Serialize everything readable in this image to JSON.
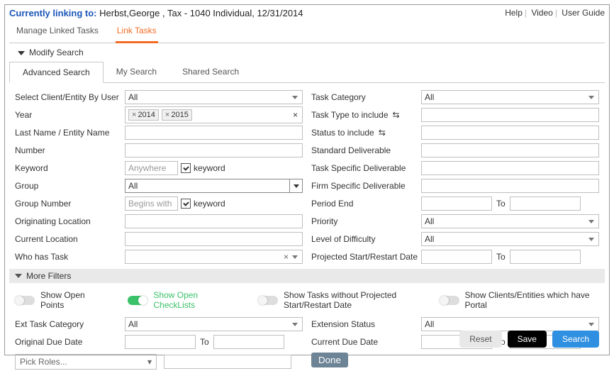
{
  "header": {
    "linking_label": "Currently linking to:",
    "linking_value": "Herbst,George , Tax - 1040 Individual, 12/31/2014",
    "help": "Help",
    "video": "Video",
    "guide": "User Guide"
  },
  "tabs_main": {
    "manage": "Manage Linked Tasks",
    "link": "Link Tasks"
  },
  "modify": "Modify Search",
  "tabs_sub": {
    "adv": "Advanced Search",
    "my": "My Search",
    "shared": "Shared Search"
  },
  "left": {
    "select_user": "Select Client/Entity By User",
    "all": "All",
    "year": "Year",
    "chip1": "2014",
    "chip2": "2015",
    "lastname": "Last Name / Entity Name",
    "number": "Number",
    "keyword": "Keyword",
    "kw_mode": "Anywhere",
    "kw_hint": "keyword",
    "group": "Group",
    "groupnum": "Group Number",
    "gn_mode": "Begins with",
    "gn_hint": "keyword",
    "orig_loc": "Originating Location",
    "curr_loc": "Current Location",
    "who": "Who has Task"
  },
  "right": {
    "cat": "Task Category",
    "all": "All",
    "type": "Task Type to include",
    "status": "Status to include",
    "std": "Standard Deliverable",
    "tsd": "Task Specific Deliverable",
    "fsd": "Firm Specific Deliverable",
    "period": "Period End",
    "to": "To",
    "priority": "Priority",
    "level": "Level of Difficulty",
    "proj": "Projected Start/Restart Date"
  },
  "more": "More Filters",
  "toggles": {
    "open_pts": "Show Open Points",
    "open_chk": "Show Open CheckLists",
    "no_proj": "Show Tasks without Projected Start/Restart Date",
    "portal": "Show Clients/Entities which have Portal"
  },
  "ext": {
    "cat": "Ext Task Category",
    "all": "All",
    "orig_due": "Original Due Date",
    "to": "To",
    "status": "Extension Status",
    "curr_due": "Current Due Date"
  },
  "roles": "Pick Roles...",
  "done": "Done",
  "buttons": {
    "reset": "Reset",
    "save": "Save",
    "search": "Search"
  }
}
